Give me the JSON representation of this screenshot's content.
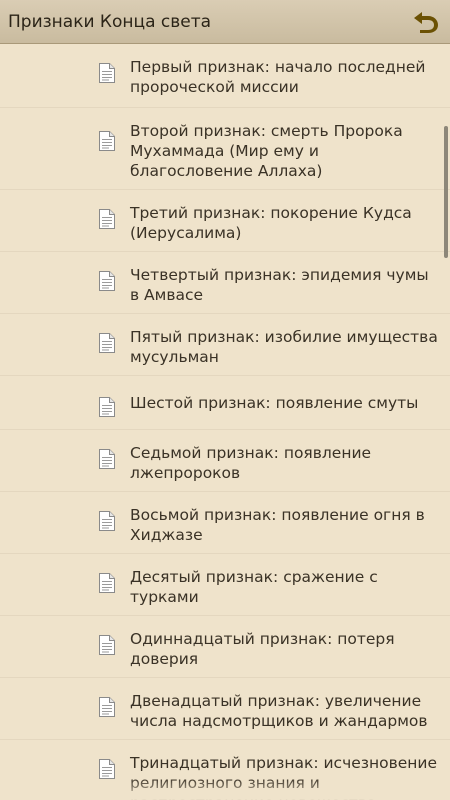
{
  "header": {
    "title": "Признаки Конца света"
  },
  "icons": {
    "back": "back-arrow-icon",
    "item": "document-icon"
  },
  "colors": {
    "background": "#efe3cb",
    "header": "#d1c3a8",
    "back_arrow": "#6b5104",
    "text": "#3a3226"
  },
  "items": [
    {
      "label": "Первый признак: начало последней пророческой миссии"
    },
    {
      "label": "Второй признак: смерть Пророка Мухаммада (Мир ему и благословение Аллаха)"
    },
    {
      "label": "Третий признак: покорение Кудса (Иерусалима)"
    },
    {
      "label": "Четвертый признак: эпидемия чумы в Амвасе"
    },
    {
      "label": "Пятый признак: изобилие имущества мусульман"
    },
    {
      "label": "Шестой признак: появление смуты"
    },
    {
      "label": "Седьмой признак: появление лжепророков"
    },
    {
      "label": "Восьмой признак: появление огня в Хиджазе"
    },
    {
      "label": "Десятый признак: сражение с турками"
    },
    {
      "label": "Одиннадцатый признак: потеря доверия"
    },
    {
      "label": "Двенадцатый признак: увеличение числа надсмотрщиков и жандармов"
    },
    {
      "label": "Тринадцатый признак: исчезновение религиозного знания и распространение невежества"
    }
  ]
}
